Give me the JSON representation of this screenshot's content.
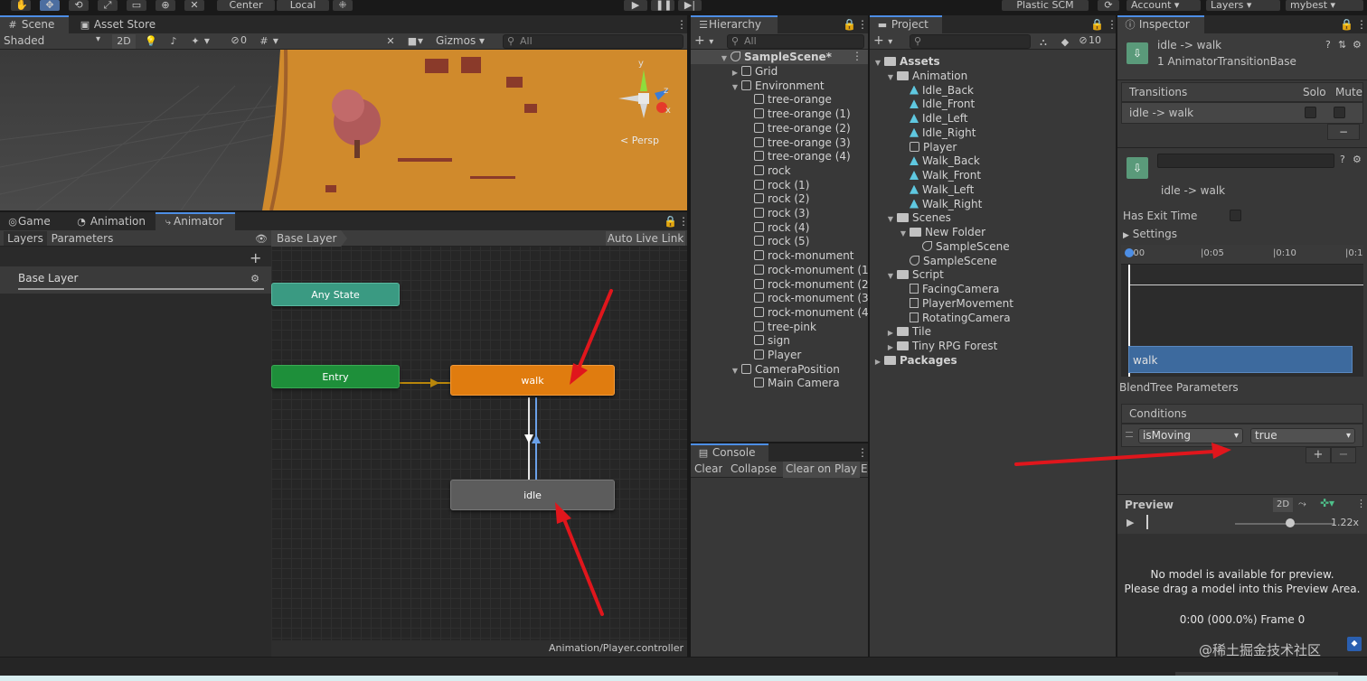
{
  "toolbar": {
    "center_label": "Center",
    "local_label": "Local",
    "plastic_label": "Plastic SCM",
    "account_label": "Account",
    "layers_label": "Layers",
    "layout_label": "mybest"
  },
  "scene": {
    "tabs": [
      "Scene",
      "Asset Store"
    ],
    "shading_mode": "Shaded",
    "mode_2d": "2D",
    "hidden_count": "0",
    "gizmos_label": "Gizmos",
    "search_placeholder": "All",
    "persp_label": "< Persp",
    "axis_y": "y",
    "axis_z": "z",
    "axis_x": "x"
  },
  "animator": {
    "tabs": [
      "Game",
      "Animation",
      "Animator"
    ],
    "left_tabs": [
      "Layers",
      "Parameters"
    ],
    "layer_name": "Base Layer",
    "breadcrumb": "Base Layer",
    "auto_live_link": "Auto Live Link",
    "states": {
      "any_state": "Any State",
      "entry": "Entry",
      "walk": "walk",
      "idle": "idle"
    },
    "footer_path": "Animation/Player.controller"
  },
  "hierarchy": {
    "title": "Hierarchy",
    "search_placeholder": "All",
    "scene_name": "SampleScene*",
    "items": [
      {
        "label": "Grid",
        "depth": 1,
        "fold": "▶"
      },
      {
        "label": "Environment",
        "depth": 1,
        "fold": "▼"
      },
      {
        "label": "tree-orange",
        "depth": 2,
        "fold": ""
      },
      {
        "label": "tree-orange (1)",
        "depth": 2,
        "fold": ""
      },
      {
        "label": "tree-orange (2)",
        "depth": 2,
        "fold": ""
      },
      {
        "label": "tree-orange (3)",
        "depth": 2,
        "fold": ""
      },
      {
        "label": "tree-orange (4)",
        "depth": 2,
        "fold": ""
      },
      {
        "label": "rock",
        "depth": 2,
        "fold": ""
      },
      {
        "label": "rock (1)",
        "depth": 2,
        "fold": ""
      },
      {
        "label": "rock (2)",
        "depth": 2,
        "fold": ""
      },
      {
        "label": "rock (3)",
        "depth": 2,
        "fold": ""
      },
      {
        "label": "rock (4)",
        "depth": 2,
        "fold": ""
      },
      {
        "label": "rock (5)",
        "depth": 2,
        "fold": ""
      },
      {
        "label": "rock-monument",
        "depth": 2,
        "fold": ""
      },
      {
        "label": "rock-monument (1",
        "depth": 2,
        "fold": ""
      },
      {
        "label": "rock-monument (2",
        "depth": 2,
        "fold": ""
      },
      {
        "label": "rock-monument (3",
        "depth": 2,
        "fold": ""
      },
      {
        "label": "rock-monument (4",
        "depth": 2,
        "fold": ""
      },
      {
        "label": "tree-pink",
        "depth": 2,
        "fold": ""
      },
      {
        "label": "sign",
        "depth": 2,
        "fold": ""
      },
      {
        "label": "Player",
        "depth": 2,
        "fold": ""
      },
      {
        "label": "CameraPosition",
        "depth": 1,
        "fold": "▼"
      },
      {
        "label": "Main Camera",
        "depth": 2,
        "fold": ""
      }
    ]
  },
  "console": {
    "title": "Console",
    "buttons": [
      "Clear",
      "Collapse",
      "Clear on Play",
      "E"
    ]
  },
  "project": {
    "title": "Project",
    "hidden_count": "10",
    "items": [
      {
        "label": "Assets",
        "depth": 0,
        "fold": "▼",
        "icon": "folder",
        "bold": true
      },
      {
        "label": "Animation",
        "depth": 1,
        "fold": "▼",
        "icon": "folder",
        "bold": false
      },
      {
        "label": "Idle_Back",
        "depth": 2,
        "fold": "",
        "icon": "anim",
        "bold": false
      },
      {
        "label": "Idle_Front",
        "depth": 2,
        "fold": "",
        "icon": "anim",
        "bold": false
      },
      {
        "label": "Idle_Left",
        "depth": 2,
        "fold": "",
        "icon": "anim",
        "bold": false
      },
      {
        "label": "Idle_Right",
        "depth": 2,
        "fold": "",
        "icon": "anim",
        "bold": false
      },
      {
        "label": "Player",
        "depth": 2,
        "fold": "",
        "icon": "controller",
        "bold": false
      },
      {
        "label": "Walk_Back",
        "depth": 2,
        "fold": "",
        "icon": "anim",
        "bold": false
      },
      {
        "label": "Walk_Front",
        "depth": 2,
        "fold": "",
        "icon": "anim",
        "bold": false
      },
      {
        "label": "Walk_Left",
        "depth": 2,
        "fold": "",
        "icon": "anim",
        "bold": false
      },
      {
        "label": "Walk_Right",
        "depth": 2,
        "fold": "",
        "icon": "anim",
        "bold": false
      },
      {
        "label": "Scenes",
        "depth": 1,
        "fold": "▼",
        "icon": "folder",
        "bold": false
      },
      {
        "label": "New Folder",
        "depth": 2,
        "fold": "▼",
        "icon": "folder",
        "bold": false
      },
      {
        "label": "SampleScene",
        "depth": 3,
        "fold": "",
        "icon": "scene",
        "bold": false
      },
      {
        "label": "SampleScene",
        "depth": 2,
        "fold": "",
        "icon": "scene",
        "bold": false
      },
      {
        "label": "Script",
        "depth": 1,
        "fold": "▼",
        "icon": "folder",
        "bold": false
      },
      {
        "label": "FacingCamera",
        "depth": 2,
        "fold": "",
        "icon": "script",
        "bold": false
      },
      {
        "label": "PlayerMovement",
        "depth": 2,
        "fold": "",
        "icon": "script",
        "bold": false
      },
      {
        "label": "RotatingCamera",
        "depth": 2,
        "fold": "",
        "icon": "script",
        "bold": false
      },
      {
        "label": "Tile",
        "depth": 1,
        "fold": "▶",
        "icon": "folder",
        "bold": false
      },
      {
        "label": "Tiny RPG Forest",
        "depth": 1,
        "fold": "▶",
        "icon": "folder",
        "bold": false
      },
      {
        "label": "Packages",
        "depth": 0,
        "fold": "▶",
        "icon": "folder",
        "bold": true
      }
    ]
  },
  "inspector": {
    "title": "Inspector",
    "header_title": "idle -> walk",
    "header_subtitle": "1 AnimatorTransitionBase",
    "transitions_label": "Transitions",
    "solo_label": "Solo",
    "mute_label": "Mute",
    "transition_item": "idle -> walk",
    "minus_label": "−",
    "sub_title": "idle -> walk",
    "has_exit_time_label": "Has Exit Time",
    "settings_label": "Settings",
    "timeline_ticks": [
      ":00",
      "|0:05",
      "|0:10",
      "|0:1"
    ],
    "timeline_clip": "walk",
    "blendtree_label": "BlendTree Parameters",
    "conditions_label": "Conditions",
    "condition_param": "isMoving",
    "condition_value": "true",
    "plus_label": "+",
    "preview_label": "Preview",
    "preview_2d": "2D",
    "preview_speed": "1.22x",
    "no_model_line1": "No model is available for preview.",
    "no_model_line2": "Please drag a model into this Preview Area.",
    "frame_readout": "0:00 (000.0%) Frame 0"
  },
  "watermark": "@稀土掘金技术社区",
  "colors": {
    "accent": "#4d8ee5",
    "walk_state": "#e07c0f",
    "entry_state": "#1e8f3a",
    "any_state": "#3a9a82",
    "idle_state": "#5c5c5c",
    "annotation": "#e0161c",
    "ground": "#d08a2c"
  }
}
